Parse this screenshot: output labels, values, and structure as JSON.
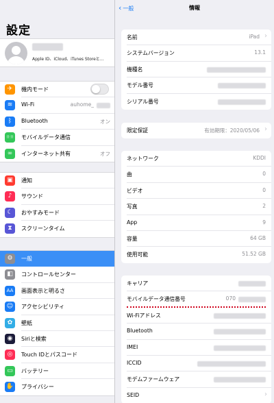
{
  "sidebar": {
    "title": "設定",
    "profile": {
      "subtitle": "Apple ID、iCloud、iTunes Storeと…"
    },
    "groups": [
      {
        "items": [
          {
            "label": "機内モード",
            "icon": "airplane-icon",
            "color": "#ff9500",
            "glyph": "✈",
            "toggle": false
          },
          {
            "label": "Wi-Fi",
            "icon": "wifi-icon",
            "color": "#1a7cf5",
            "glyph": "≋",
            "value": "auhome_"
          },
          {
            "label": "Bluetooth",
            "icon": "bluetooth-icon",
            "color": "#1a7cf5",
            "glyph": "ᛒ",
            "value": "オン"
          },
          {
            "label": "モバイルデータ通信",
            "icon": "antenna-icon",
            "color": "#34c759",
            "glyph": "((·))"
          },
          {
            "label": "インターネット共有",
            "icon": "hotspot-icon",
            "color": "#34c759",
            "glyph": "∞",
            "value": "オフ"
          }
        ]
      },
      {
        "items": [
          {
            "label": "通知",
            "icon": "notifications-icon",
            "color": "#ff3b30",
            "glyph": "▣"
          },
          {
            "label": "サウンド",
            "icon": "speaker-icon",
            "color": "#ff2d55",
            "glyph": "♪"
          },
          {
            "label": "おやすみモード",
            "icon": "moon-icon",
            "color": "#5856d6",
            "glyph": "☾"
          },
          {
            "label": "スクリーンタイム",
            "icon": "hourglass-icon",
            "color": "#5856d6",
            "glyph": "⧗"
          }
        ]
      },
      {
        "items": [
          {
            "label": "一般",
            "icon": "gear-icon",
            "color": "#8e8e93",
            "glyph": "⚙",
            "selected": true
          },
          {
            "label": "コントロールセンター",
            "icon": "switches-icon",
            "color": "#8e8e93",
            "glyph": "◧"
          },
          {
            "label": "画面表示と明るさ",
            "icon": "text-size-icon",
            "color": "#1a7cf5",
            "glyph": "AA"
          },
          {
            "label": "アクセシビリティ",
            "icon": "accessibility-icon",
            "color": "#1a7cf5",
            "glyph": "☺"
          },
          {
            "label": "壁紙",
            "icon": "flower-icon",
            "color": "#32ade6",
            "glyph": "✿"
          },
          {
            "label": "Siriと検索",
            "icon": "siri-icon",
            "color": "#1c1c3a",
            "glyph": "◉"
          },
          {
            "label": "Touch IDとパスコード",
            "icon": "fingerprint-icon",
            "color": "#ff2d55",
            "glyph": "◎"
          },
          {
            "label": "バッテリー",
            "icon": "battery-icon",
            "color": "#34c759",
            "glyph": "▭"
          },
          {
            "label": "プライバシー",
            "icon": "hand-icon",
            "color": "#1a7cf5",
            "glyph": "✋"
          }
        ]
      }
    ]
  },
  "detail": {
    "back_label": "一般",
    "title": "情報",
    "groups": [
      {
        "rows": [
          {
            "label": "名前",
            "value": "iPad",
            "chevron": true
          },
          {
            "label": "システムバージョン",
            "value": "13.1"
          },
          {
            "label": "機種名",
            "hidden": true
          },
          {
            "label": "モデル番号",
            "hidden": true
          },
          {
            "label": "シリアル番号",
            "hidden": true
          }
        ]
      },
      {
        "rows": [
          {
            "label": "限定保証",
            "value": "有効期限：2020/05/06",
            "chevron": true
          }
        ]
      },
      {
        "rows": [
          {
            "label": "ネットワーク",
            "value": "KDDI"
          },
          {
            "label": "曲",
            "value": "0"
          },
          {
            "label": "ビデオ",
            "value": "0"
          },
          {
            "label": "写真",
            "value": "2"
          },
          {
            "label": "App",
            "value": "9"
          },
          {
            "label": "容量",
            "value": "64 GB"
          },
          {
            "label": "使用可能",
            "value": "51.52 GB"
          }
        ]
      },
      {
        "rows": [
          {
            "label": "キャリア",
            "hidden": true
          },
          {
            "label": "モバイルデータ通信番号",
            "value": "070",
            "hidden": true,
            "highlight": true
          },
          {
            "label": "Wi-Fiアドレス",
            "hidden": true
          },
          {
            "label": "Bluetooth",
            "hidden": true
          },
          {
            "label": "IMEI",
            "hidden": true
          },
          {
            "label": "ICCID",
            "hidden": true
          },
          {
            "label": "モデムファームウェア",
            "hidden": true
          },
          {
            "label": "SEID",
            "chevron": true
          }
        ]
      }
    ]
  }
}
